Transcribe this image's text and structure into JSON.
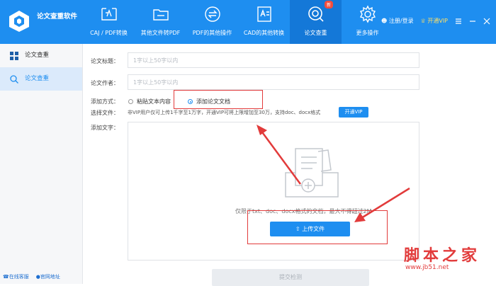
{
  "app": {
    "title": "论文查重软件"
  },
  "nav": [
    {
      "label": "CAJ / PDF转换",
      "icon": "caj-pdf-convert-icon",
      "active": false
    },
    {
      "label": "其他文件转PDF",
      "icon": "folder-icon",
      "active": false
    },
    {
      "label": "PDF的其他操作",
      "icon": "pdf-exchange-icon",
      "active": false
    },
    {
      "label": "CAD的其他转换",
      "icon": "cad-icon",
      "active": false
    },
    {
      "label": "论文查重",
      "icon": "thesis-check-icon",
      "active": true,
      "badge": "新"
    },
    {
      "label": "更多操作",
      "icon": "gear-icon",
      "active": false
    }
  ],
  "header_right": {
    "login": "注册/登录",
    "vip": "开通VIP"
  },
  "sidebar": {
    "items": [
      {
        "label": "论文查重",
        "icon": "grid-icon",
        "active": false
      },
      {
        "label": "论文查重",
        "icon": "search-icon",
        "active": true
      }
    ],
    "footer": {
      "service": "在线客服",
      "website": "官网地址"
    }
  },
  "form": {
    "title_label": "论文标题：",
    "title_placeholder": "1字以上50字以内",
    "author_label": "论文作者：",
    "author_placeholder": "1字以上50字以内",
    "method_label": "添加方式：",
    "method_paste": "粘贴文本内容",
    "method_upload": "添加论文文档",
    "file_label": "选择文件：",
    "file_note": "非VIP用户仅可上传1千字至1万字，开通VIP可将上限增加至30万，支持doc、docx格式",
    "vip_button": "开通VIP",
    "text_label": "添加文字：",
    "drop_hint": "仅限于txt、doc、docx格式的文档，最大不得超过2M",
    "upload_button": "上传文件",
    "submit_button": "提交检测"
  },
  "watermark": {
    "text": "脚本之家",
    "url": "www.jb51.net"
  },
  "colors": {
    "primary": "#1e8ef0",
    "annotation": "#e23b3b"
  }
}
